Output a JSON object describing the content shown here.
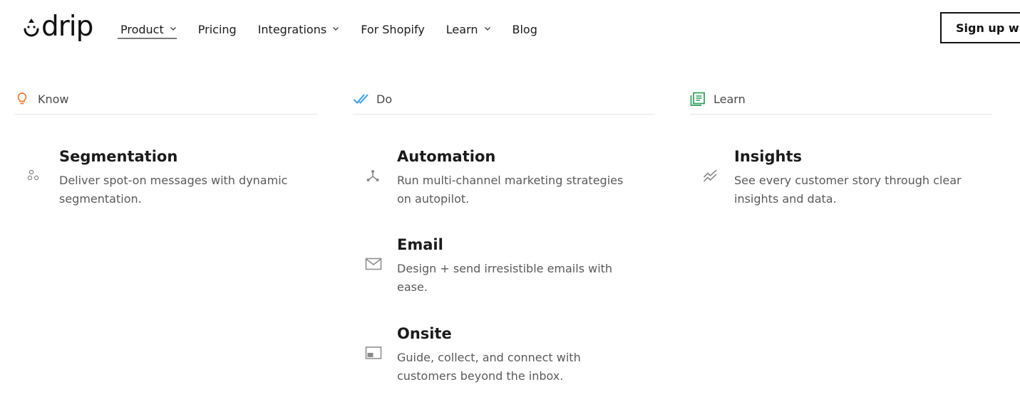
{
  "brand": {
    "name": "drip"
  },
  "nav": {
    "items": [
      {
        "label": "Product",
        "has_dropdown": true,
        "active": true
      },
      {
        "label": "Pricing",
        "has_dropdown": false
      },
      {
        "label": "Integrations",
        "has_dropdown": true
      },
      {
        "label": "For Shopify",
        "has_dropdown": false
      },
      {
        "label": "Learn",
        "has_dropdown": true
      },
      {
        "label": "Blog",
        "has_dropdown": false
      }
    ],
    "signup_label": "Sign up with"
  },
  "columns": [
    {
      "heading": "Know",
      "heading_icon": "lightbulb-icon",
      "heading_color": "#f0782b",
      "items": [
        {
          "title": "Segmentation",
          "description": "Deliver spot-on messages with dynamic segmentation.",
          "icon": "segments-icon"
        }
      ]
    },
    {
      "heading": "Do",
      "heading_icon": "double-check-icon",
      "heading_color": "#3aa0e8",
      "items": [
        {
          "title": "Automation",
          "description": "Run multi-channel marketing strategies on autopilot.",
          "icon": "workflow-icon"
        },
        {
          "title": "Email",
          "description": "Design + send irresistible emails with ease.",
          "icon": "envelope-icon"
        },
        {
          "title": "Onsite",
          "description": "Guide, collect, and connect with customers beyond the inbox.",
          "icon": "popup-window-icon"
        }
      ]
    },
    {
      "heading": "Learn",
      "heading_icon": "report-icon",
      "heading_color": "#2e9e5b",
      "items": [
        {
          "title": "Insights",
          "description": "See every customer story through clear insights and data.",
          "icon": "trend-lines-icon"
        }
      ]
    }
  ],
  "colors": {
    "text": "#1b1b1b",
    "muted": "#5a5a5a",
    "divider": "#e4e4e4",
    "icon_gray": "#8a8a8a"
  }
}
